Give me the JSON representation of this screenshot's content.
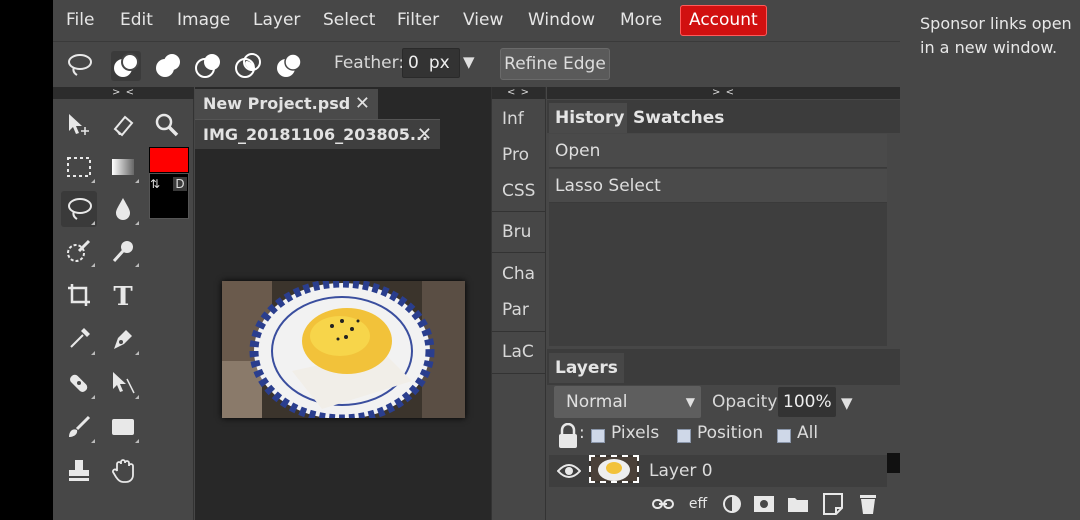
{
  "menu": {
    "items": [
      "File",
      "Edit",
      "Image",
      "Layer",
      "Select",
      "Filter",
      "View",
      "Window",
      "More"
    ],
    "account": "Account"
  },
  "options": {
    "feather_label": "Feather:",
    "feather_value": "0",
    "feather_unit": "px",
    "refine_edge": "Refine Edge"
  },
  "colors": {
    "foreground": "#ff0000",
    "background": "#000000",
    "swap": "⇅",
    "default": "D"
  },
  "tools_panel": {
    "collapse": "> <"
  },
  "documents": {
    "tabs": [
      {
        "title": "New Project.psd",
        "close": "✕"
      },
      {
        "title": "IMG_20181106_203805...",
        "close": "✕"
      }
    ]
  },
  "mini_panels": {
    "collapse": "< >",
    "items": [
      "Inf",
      "Pro",
      "CSS",
      "Bru",
      "Cha",
      "Par",
      "LaC"
    ]
  },
  "right_panel": {
    "collapse": "> <",
    "tabs": [
      "History",
      "Swatches"
    ],
    "history": [
      "Open",
      "Lasso Select"
    ],
    "layers": {
      "title": "Layers",
      "blend_mode": "Normal",
      "opacity_label": "Opacity:",
      "opacity_value": "100%",
      "lock_colon": ":",
      "lock_options": [
        "Pixels",
        "Position",
        "All"
      ],
      "layer_name": "Layer 0",
      "footer_eff": "eff"
    }
  },
  "sponsor": "Sponsor links open in a new window."
}
